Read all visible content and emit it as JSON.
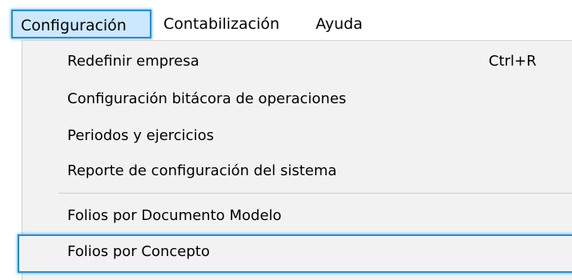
{
  "menubar": {
    "items": [
      {
        "label": "Configuración"
      },
      {
        "label": "Contabilización"
      },
      {
        "label": "Ayuda"
      }
    ]
  },
  "dropdown": {
    "items": [
      {
        "label": "Redefinir empresa",
        "shortcut": "Ctrl+R"
      },
      {
        "label": "Configuración bitácora de operaciones"
      },
      {
        "label": "Periodos y ejercicios"
      },
      {
        "label": "Reporte de configuración del sistema"
      },
      {
        "label": "Folios por Documento Modelo"
      },
      {
        "label": "Folios por Concepto"
      }
    ]
  },
  "colors": {
    "highlight_border": "#1f8fd8",
    "selected_background": "#cce8ff",
    "menu_background": "#f2f2f2"
  }
}
